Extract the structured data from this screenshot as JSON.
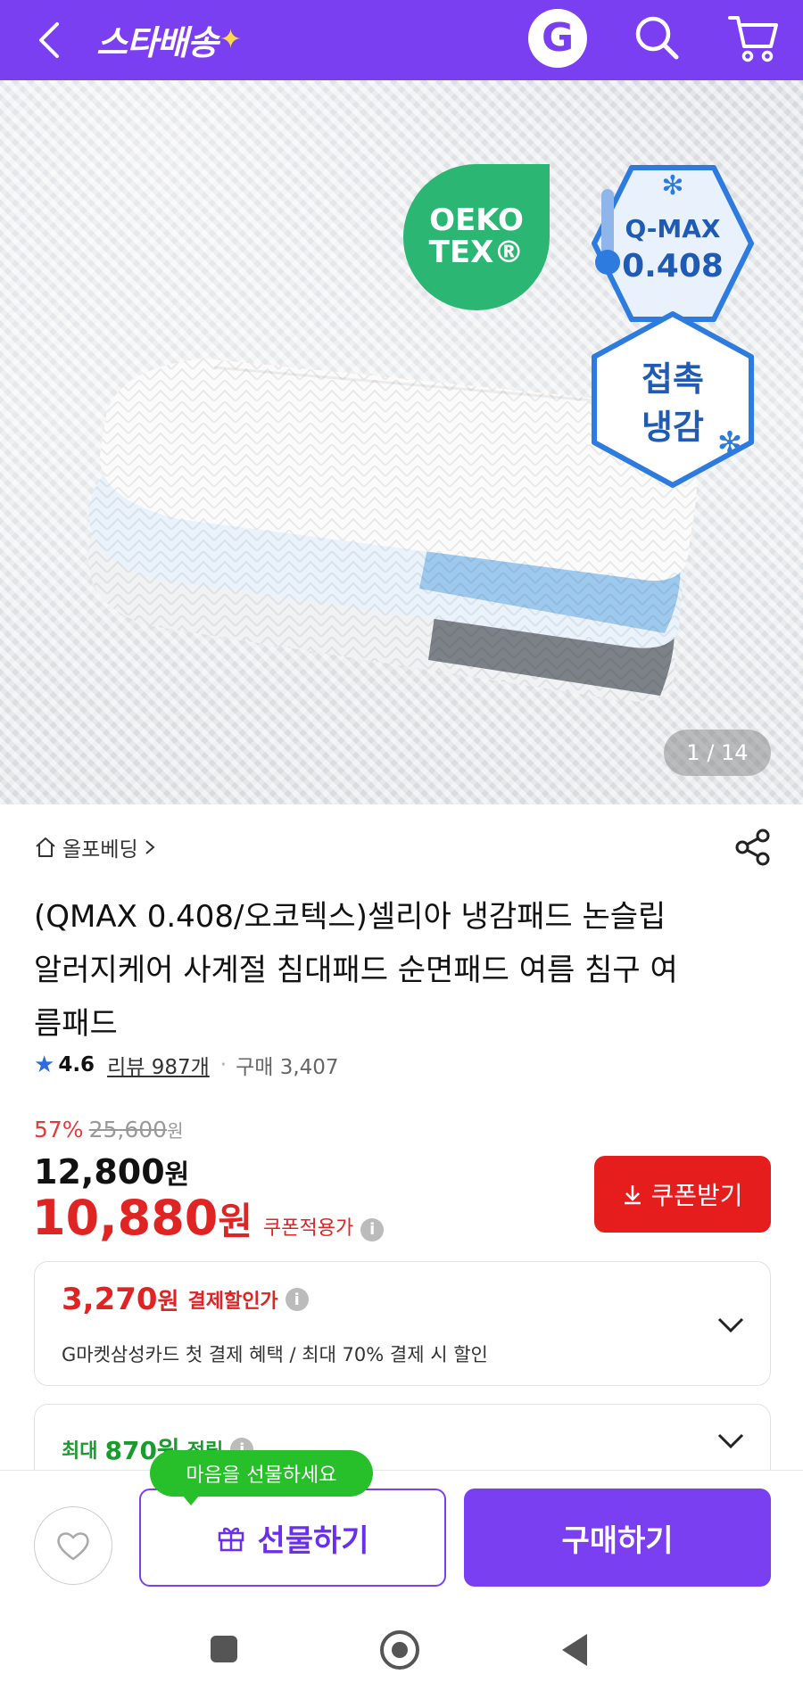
{
  "header": {
    "brand": "스타배송",
    "brand_spark": "✦",
    "g_label": "G"
  },
  "hero": {
    "counter": "1 / 14",
    "oeko_line1": "OEKO",
    "oeko_line2": "TEX®",
    "qmax_label": "Q-MAX",
    "qmax_value": "0.408",
    "cooling_line1": "접촉",
    "cooling_line2": "냉감"
  },
  "product": {
    "seller": "올포베딩",
    "title": "(QMAX 0.408/오코텍스)셀리아 냉감패드 논슬립 알러지케어 사계절 침대패드 순면패드 여름 침구 여름패드",
    "rating": "4.6",
    "review_label": "리뷰 987개",
    "purchase_label": "구매 3,407",
    "discount_rate": "57%",
    "original_price": "25,600",
    "original_unit": "원",
    "price": "12,800",
    "price_unit": "원",
    "coupon_price": "10,880",
    "coupon_unit": "원",
    "coupon_price_label": "쿠폰적용가",
    "coupon_button": "쿠폰받기"
  },
  "payment_card": {
    "amount": "3,270",
    "unit": "원",
    "label": "결제할인가",
    "sub": "G마켓삼성카드 첫 결제 혜택 / 최대 70% 결제 시 할인"
  },
  "points_card": {
    "prefix": "최대",
    "amount": "870원",
    "label": "적립"
  },
  "bottom": {
    "bubble": "마음을 선물하세요",
    "gift_label": "선물하기",
    "buy_label": "구매하기"
  },
  "colors": {
    "brand": "#7b3ff2",
    "price_red": "#e02424",
    "coupon_red": "#e51d1d",
    "green": "#27bf2a"
  }
}
